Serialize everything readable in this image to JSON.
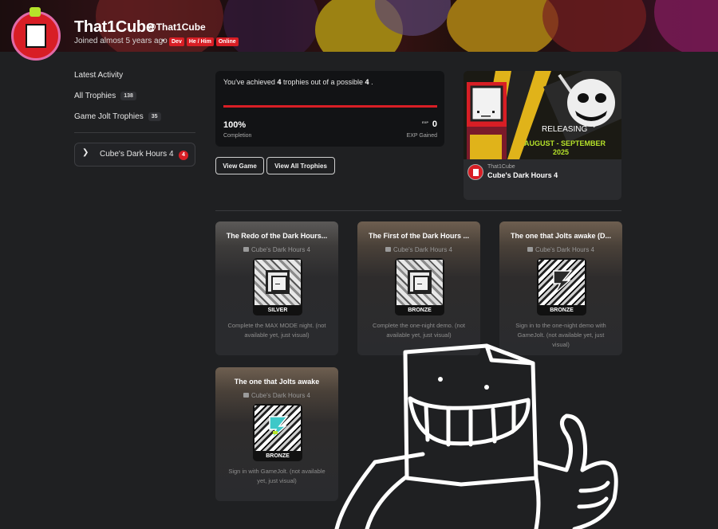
{
  "profile": {
    "username": "That1Cube",
    "handle": "@That1Cube",
    "joined": "Joined almost 5 years ago",
    "separator": "•",
    "badges": [
      "Dev",
      "He / Him",
      "Online"
    ]
  },
  "sidebar": {
    "latest_activity": "Latest Activity",
    "all_trophies": "All Trophies",
    "all_trophies_count": "138",
    "gj_trophies": "Game Jolt Trophies",
    "gj_trophies_count": "35",
    "game_filter": {
      "label": "Cube's Dark Hours 4",
      "count": "4"
    }
  },
  "summary": {
    "prefix": "You've achieved ",
    "achieved": "4",
    "middle": " trophies out of a possible ",
    "possible": "4",
    "suffix": " .",
    "progress_fraction": 1.0,
    "completion_value": "100%",
    "completion_label": "Completion",
    "exp_icon": "EXP",
    "exp_value": "0",
    "exp_label": "EXP Gained"
  },
  "buttons": {
    "view_game": "View Game",
    "view_all": "View All Trophies"
  },
  "game_card": {
    "art_text_1": "RELEASING",
    "art_text_2": "AUGUST - SEPTEMBER",
    "art_text_3": "2025",
    "developer": "That1Cube",
    "title": "Cube's Dark Hours 4"
  },
  "trophies": [
    {
      "title": "The Redo of the Dark Hours...",
      "game": "Cube's Dark Hours 4",
      "tier": "SILVER",
      "icon": "cube-face-icon",
      "description": "Complete the MAX MODE night. (not available yet, just visual)"
    },
    {
      "title": "The First of the Dark Hours ...",
      "game": "Cube's Dark Hours 4",
      "tier": "BRONZE",
      "icon": "cube-face-icon",
      "description": "Complete the one-night demo. (not available yet, just visual)"
    },
    {
      "title": "The one that Jolts awake (D...",
      "game": "Cube's Dark Hours 4",
      "tier": "BRONZE",
      "icon": "gamejolt-bolt-icon",
      "description": "Sign in to the one-night demo with GameJolt. (not available yet, just visual)"
    },
    {
      "title": "The one that Jolts awake",
      "game": "Cube's Dark Hours 4",
      "tier": "BRONZE",
      "icon": "gamejolt-bolt-icon",
      "description": "Sign in with GameJolt. (not available yet, just visual)"
    }
  ],
  "colors": {
    "accent_red": "#d81e25",
    "background": "#1f2022",
    "card": "#2a2b2e",
    "highlight_green": "#b6e32a"
  }
}
